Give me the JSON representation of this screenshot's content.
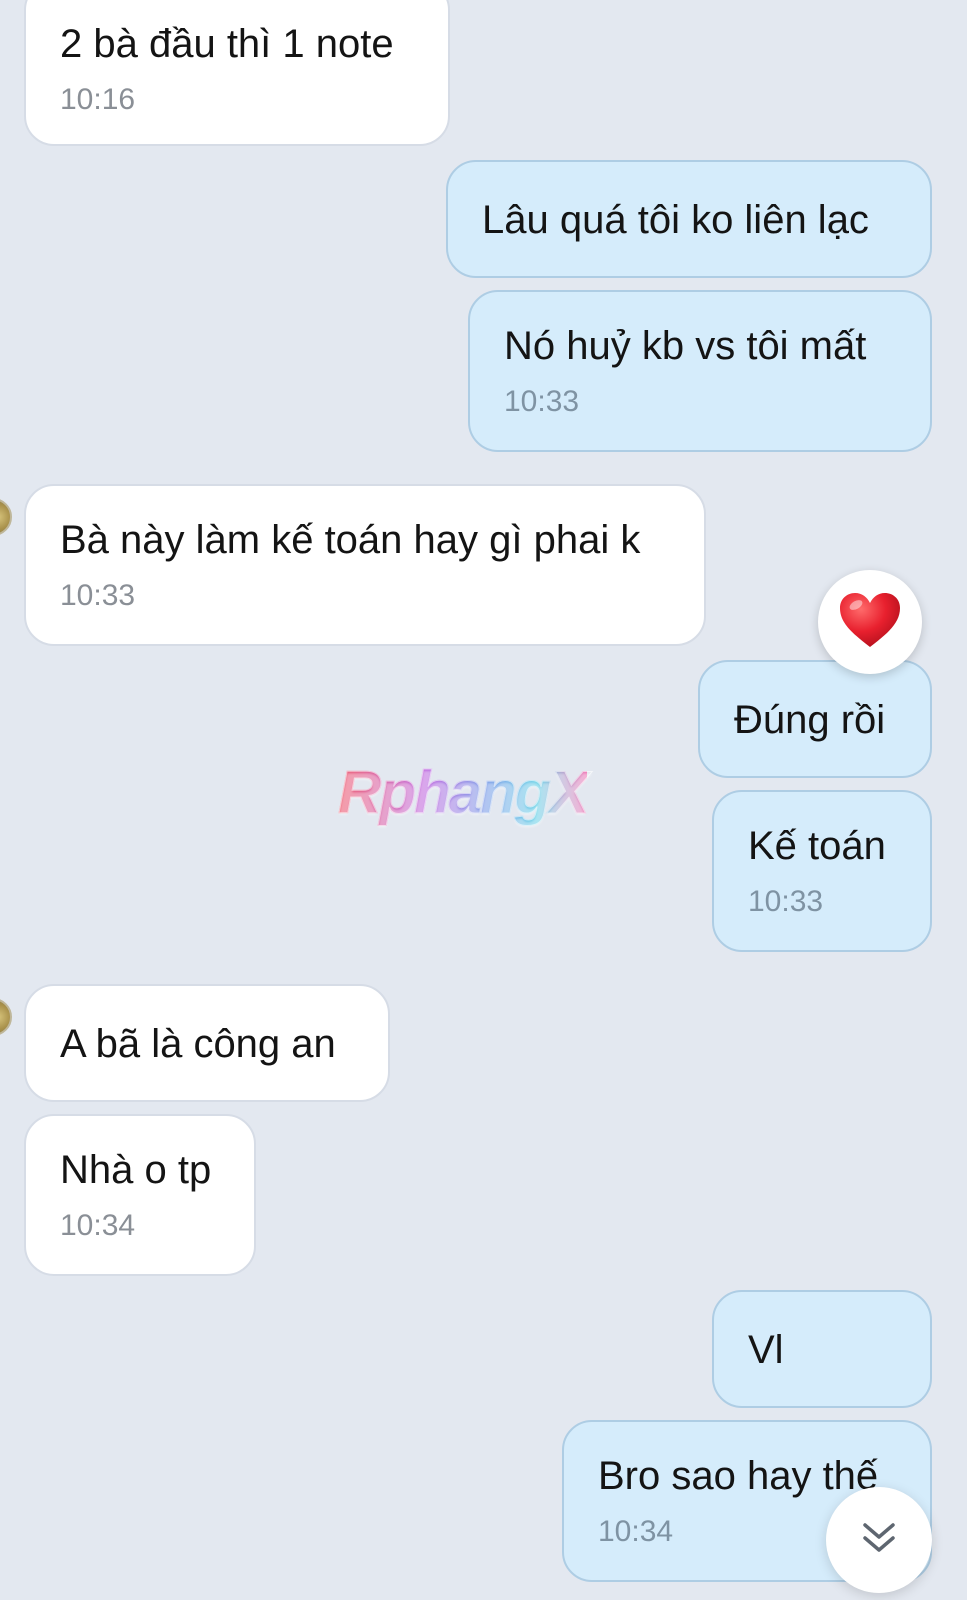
{
  "conversation": {
    "messages": [
      {
        "side": "incoming",
        "text": "2 bà đầu thì 1 note",
        "time": "10:16"
      },
      {
        "side": "outgoing",
        "text": "Lâu quá tôi ko liên lạc",
        "time": ""
      },
      {
        "side": "outgoing",
        "text": "Nó huỷ kb vs tôi mất",
        "time": "10:33"
      },
      {
        "side": "incoming",
        "text": "Bà này làm kế toán hay gì phai k",
        "time": "10:33"
      },
      {
        "side": "outgoing",
        "text": "Đúng rồi",
        "time": "",
        "reaction": "heart"
      },
      {
        "side": "outgoing",
        "text": "Kế toán",
        "time": "10:33"
      },
      {
        "side": "incoming",
        "text": "A bã là công an",
        "time": ""
      },
      {
        "side": "incoming",
        "text": "Nhà o tp",
        "time": "10:34"
      },
      {
        "side": "outgoing",
        "text": "Vl",
        "time": ""
      },
      {
        "side": "outgoing",
        "text": "Bro sao hay thế",
        "time": "10:34"
      }
    ]
  },
  "watermark": {
    "text": "RphangX"
  },
  "icons": {
    "reaction": "heart-icon",
    "scroll": "double-chevron-down-icon"
  },
  "colors": {
    "background": "#e3e8f0",
    "incoming_bubble": "#ffffff",
    "outgoing_bubble": "#d5ecfb",
    "heart": "#e8202e"
  }
}
